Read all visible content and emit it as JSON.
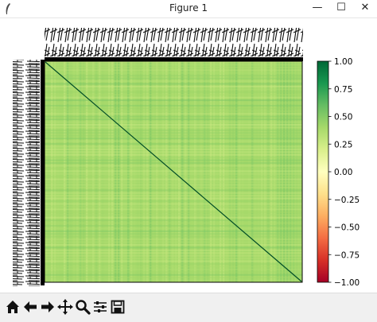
{
  "window": {
    "title": "Figure 1",
    "controls": {
      "minimize": "—",
      "maximize": "☐",
      "close": "✕"
    }
  },
  "toolbar": {
    "tools": [
      "home-icon",
      "back-icon",
      "forward-icon",
      "pan-icon",
      "zoom-icon",
      "configure-subplots-icon",
      "save-icon"
    ]
  },
  "chart_data": {
    "type": "heatmap",
    "title": "",
    "xlabel": "",
    "ylabel": "",
    "colormap": "RdYlGn",
    "value_range": [
      -1.0,
      1.0
    ],
    "diagonal_value": 1.0,
    "typical_off_diagonal_range": [
      0.25,
      0.55
    ],
    "tick_labels_overlapping": true,
    "colorbar": {
      "ticks": [
        "1.00",
        "0.75",
        "0.50",
        "0.25",
        "0.00",
        "−0.25",
        "−0.50",
        "−0.75",
        "−1.00"
      ]
    }
  }
}
